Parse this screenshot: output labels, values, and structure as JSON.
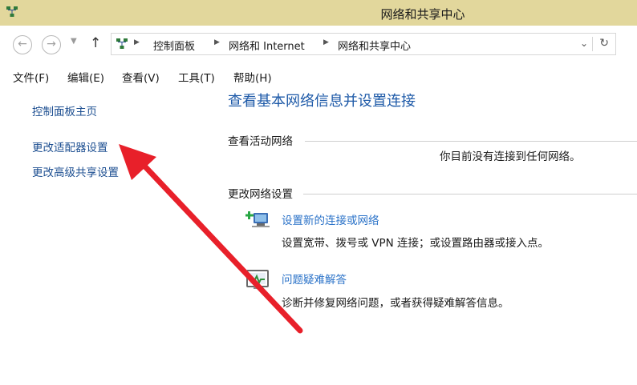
{
  "window": {
    "title": "网络和共享中心"
  },
  "address": {
    "crumbs": [
      "控制面板",
      "网络和 Internet",
      "网络和共享中心"
    ]
  },
  "menu": {
    "file": "文件(F)",
    "edit": "编辑(E)",
    "view": "查看(V)",
    "tools": "工具(T)",
    "help": "帮助(H)"
  },
  "sidebar": {
    "home": "控制面板主页",
    "adapter": "更改适配器设置",
    "advanced_sharing": "更改高级共享设置"
  },
  "main": {
    "title": "查看基本网络信息并设置连接",
    "active_networks_label": "查看活动网络",
    "no_network_text": "你目前没有连接到任何网络。",
    "change_settings_label": "更改网络设置",
    "tasks": [
      {
        "link": "设置新的连接或网络",
        "desc": "设置宽带、拨号或 VPN 连接；或设置路由器或接入点。",
        "icon": "network-setup-icon"
      },
      {
        "link": "问题疑难解答",
        "desc": "诊断并修复网络问题，或者获得疑难解答信息。",
        "icon": "troubleshoot-icon"
      }
    ]
  },
  "colors": {
    "titlebar": "#e2d79c",
    "link": "#1d4f91",
    "heading": "#1e5aa8",
    "annotation_arrow": "#e8202a"
  }
}
